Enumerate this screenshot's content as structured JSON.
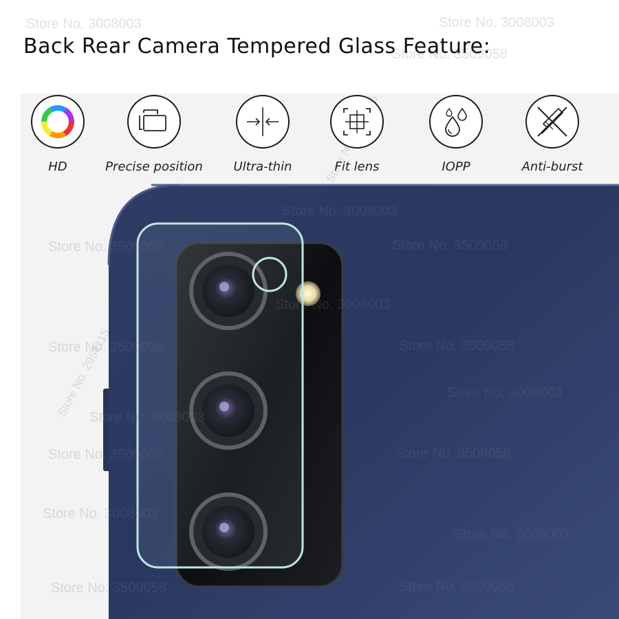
{
  "title": "Back Rear Camera Tempered Glass Feature:",
  "features": [
    {
      "label": "HD",
      "icon": "color-ring-icon"
    },
    {
      "label": "Precise position",
      "icon": "precise-position-icon"
    },
    {
      "label": "Ultra-thin",
      "icon": "ultra-thin-icon"
    },
    {
      "label": "Fit lens",
      "icon": "fit-lens-icon"
    },
    {
      "label": "IOPP",
      "icon": "water-drops-icon"
    },
    {
      "label": "Anti-burst",
      "icon": "anti-burst-icon"
    }
  ],
  "watermarks": {
    "a": "Store No. 3008003",
    "b": "Store No. 3509058",
    "c": "Store No. 2954115"
  },
  "colors": {
    "phone_body": "#27345a",
    "camera_module": "#141418",
    "glass_outline": "#bfe8e0"
  }
}
